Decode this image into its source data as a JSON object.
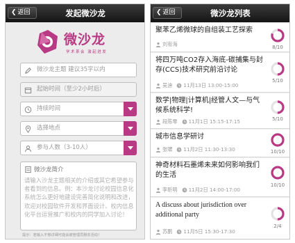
{
  "left": {
    "back_label": "返回",
    "title": "发起微沙龙",
    "logo": {
      "title": "微沙龙",
      "sub": "学术茶会  激起迸发"
    },
    "fields": {
      "topic": "微沙龙主题 建议35字以内",
      "start": "起始时间（至少2小时后）",
      "duration": "持续时间",
      "location": "选择地点",
      "people": "参与人数（3-10人）"
    },
    "desc": {
      "heading": "微沙龙简介",
      "placeholder": "请输入沙龙主题相关的介绍或其它希望参与者看到的信息。例：本沙龙讨论校园信息化系统怎么更好地建设完善简化说明和改进，欢迎对校园软件开发和界面设计、校内信息化平台运营推广和校内的同学加入讨论！"
    },
    "hint": "提示：若输入不够详细可能会被管理员删去活动！",
    "accent": "#b83a84"
  },
  "right": {
    "back_label": "返回",
    "title": "微沙龙列表",
    "items": [
      {
        "title": "聚苯乙烯微球的自组装工艺探索",
        "user": "刘有海",
        "time": "",
        "ratio": "8/10",
        "progress": 0.8
      },
      {
        "title": "将四万吨CO2存入海底-碳捕集与封存(CCS)技术研究前沿讨论",
        "user": "吴迪",
        "time": "11月13日 13:00-15:00",
        "ratio": "5/10",
        "progress": 0.5
      },
      {
        "title": "数学|物理|计算机|经管人文—与气候系统科学!",
        "user": "段陈零",
        "time": "11月1日 15:15-17:15",
        "ratio": "5/10",
        "progress": 0.5
      },
      {
        "title": "城市信息学研讨",
        "user": "张啸",
        "time": "11月2日 11:30-13:30",
        "ratio": "10/10",
        "progress": 1.0
      },
      {
        "title": "神奇材料石墨烯未来如何影响我们的生活",
        "user": "李昕明",
        "time": "11月2日 14:00-17:00",
        "ratio": "10/10",
        "progress": 1.0
      },
      {
        "title": "A discuss about jurisdiction over additional party",
        "user": "苏鹏",
        "time": "11月5日 15:30-17:30",
        "ratio": "2/4",
        "progress": 0.5
      }
    ]
  }
}
